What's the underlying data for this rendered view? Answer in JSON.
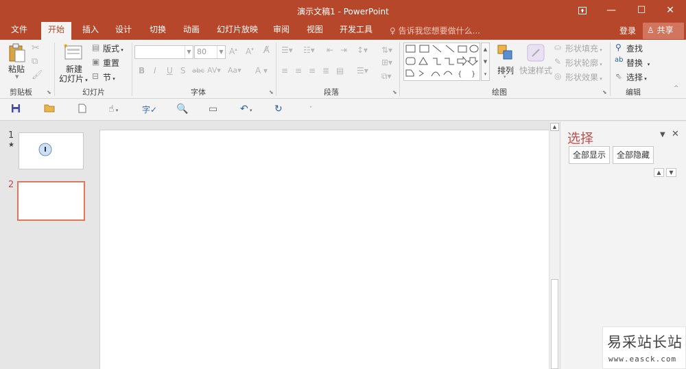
{
  "window": {
    "title": "演示文稿1 - PowerPoint",
    "restore_icon": "ribbon-display-options-icon",
    "minimize": "—",
    "maximize": "☐",
    "close": "✕"
  },
  "tabs": [
    "文件",
    "开始",
    "插入",
    "设计",
    "切换",
    "动画",
    "幻灯片放映",
    "审阅",
    "视图",
    "开发工具"
  ],
  "active_tab": "开始",
  "tell_me": "告诉我您想要做什么...",
  "account": {
    "login": "登录",
    "share": "共享"
  },
  "ribbon": {
    "clipboard": {
      "label": "剪贴板",
      "paste": "粘贴"
    },
    "slides": {
      "label": "幻灯片",
      "new_slide_line1": "新建",
      "new_slide_line2": "幻灯片",
      "layout": "版式",
      "reset": "重置",
      "section": "节"
    },
    "font": {
      "label": "字体",
      "font_name": "",
      "font_size": "80"
    },
    "paragraph": {
      "label": "段落"
    },
    "drawing": {
      "label": "绘图",
      "arrange": "排列",
      "quick_styles": "快速样式",
      "shape_fill": "形状填充",
      "shape_outline": "形状轮廓",
      "shape_effects": "形状效果"
    },
    "editing": {
      "label": "编辑",
      "find": "查找",
      "replace": "替换",
      "select": "选择"
    }
  },
  "slides": [
    {
      "number": "1",
      "marker": "★"
    },
    {
      "number": "2",
      "marker": ""
    }
  ],
  "selection_pane": {
    "title": "选择",
    "show_all": "全部显示",
    "hide_all": "全部隐藏"
  },
  "watermark": {
    "cn": "易采站长站",
    "url": "www.easck.com"
  },
  "colors": {
    "accent": "#b7472a",
    "selected_slide_border": "#e07657",
    "pane_title": "#c0504d"
  }
}
